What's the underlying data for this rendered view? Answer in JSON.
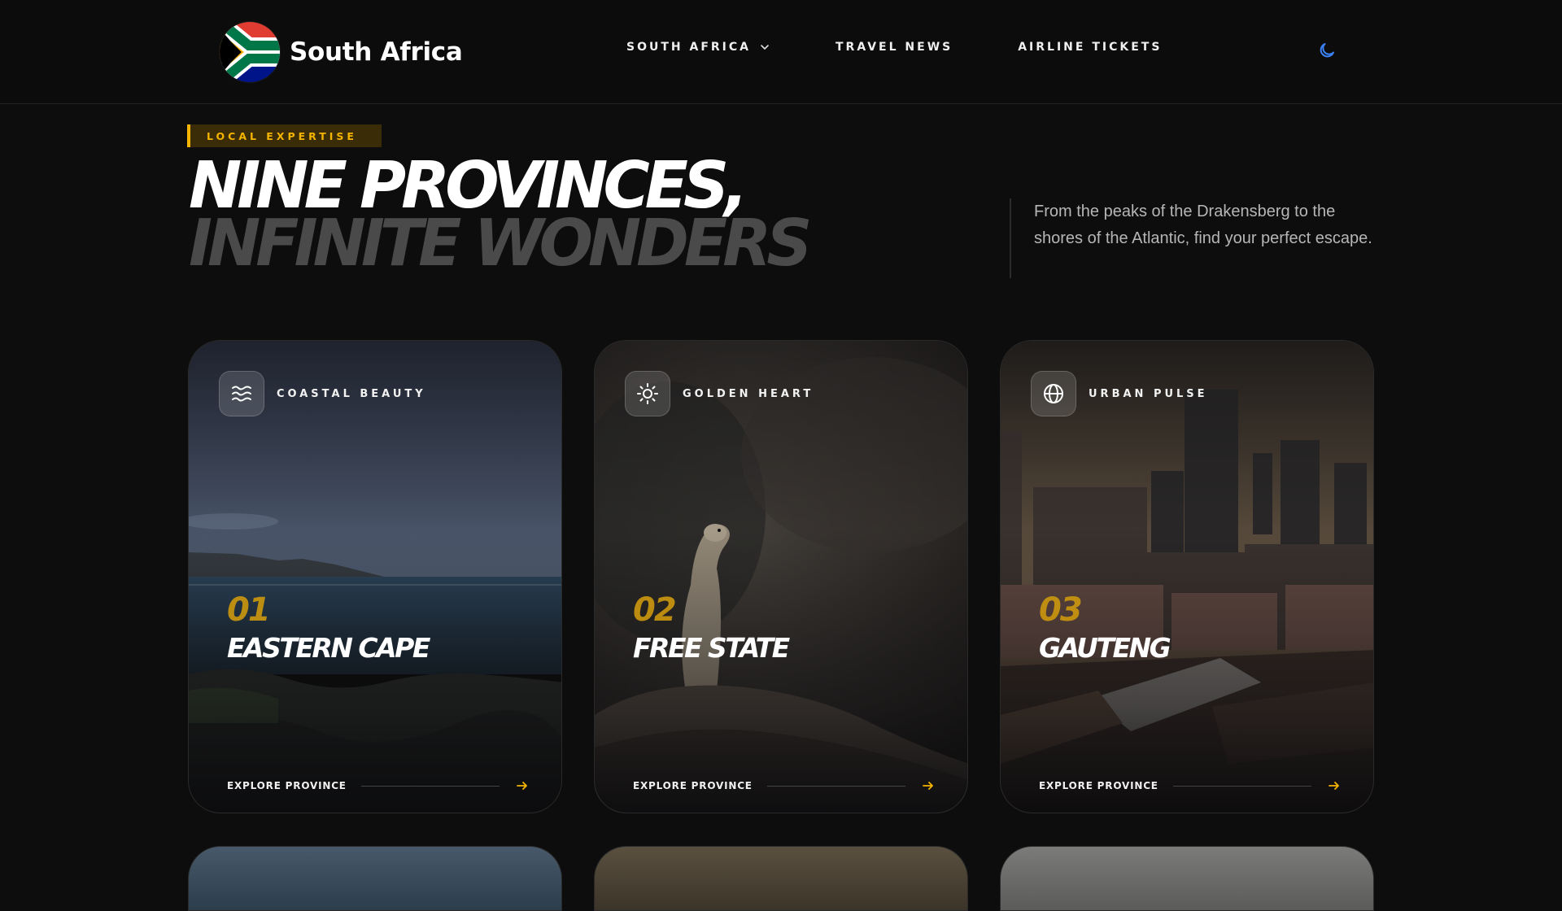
{
  "header": {
    "brand_name": "South Africa",
    "nav": [
      {
        "label": "SOUTH AFRICA",
        "has_dropdown": true
      },
      {
        "label": "TRAVEL NEWS",
        "has_dropdown": false
      },
      {
        "label": "AIRLINE TICKETS",
        "has_dropdown": false
      }
    ],
    "theme_icon": "moon-icon"
  },
  "hero": {
    "badge": "LOCAL EXPERTISE",
    "title_line1": "NINE PROVINCES,",
    "title_line2": "INFINITE WONDERS",
    "lead": "From the peaks of the Drakensberg to the shores of the Atlantic, find your perfect escape."
  },
  "cards": [
    {
      "icon": "waves-icon",
      "tag": "COASTAL BEAUTY",
      "number": "01",
      "name": "EASTERN CAPE",
      "cta": "EXPLORE PROVINCE"
    },
    {
      "icon": "sun-icon",
      "tag": "GOLDEN HEART",
      "number": "02",
      "name": "FREE STATE",
      "cta": "EXPLORE PROVINCE"
    },
    {
      "icon": "globe-icon",
      "tag": "URBAN PULSE",
      "number": "03",
      "name": "GAUTENG",
      "cta": "EXPLORE PROVINCE"
    }
  ],
  "colors": {
    "accent": "#f5b400",
    "number": "#c9960f",
    "background": "#0d0d0d",
    "moon": "#3b82f6"
  }
}
